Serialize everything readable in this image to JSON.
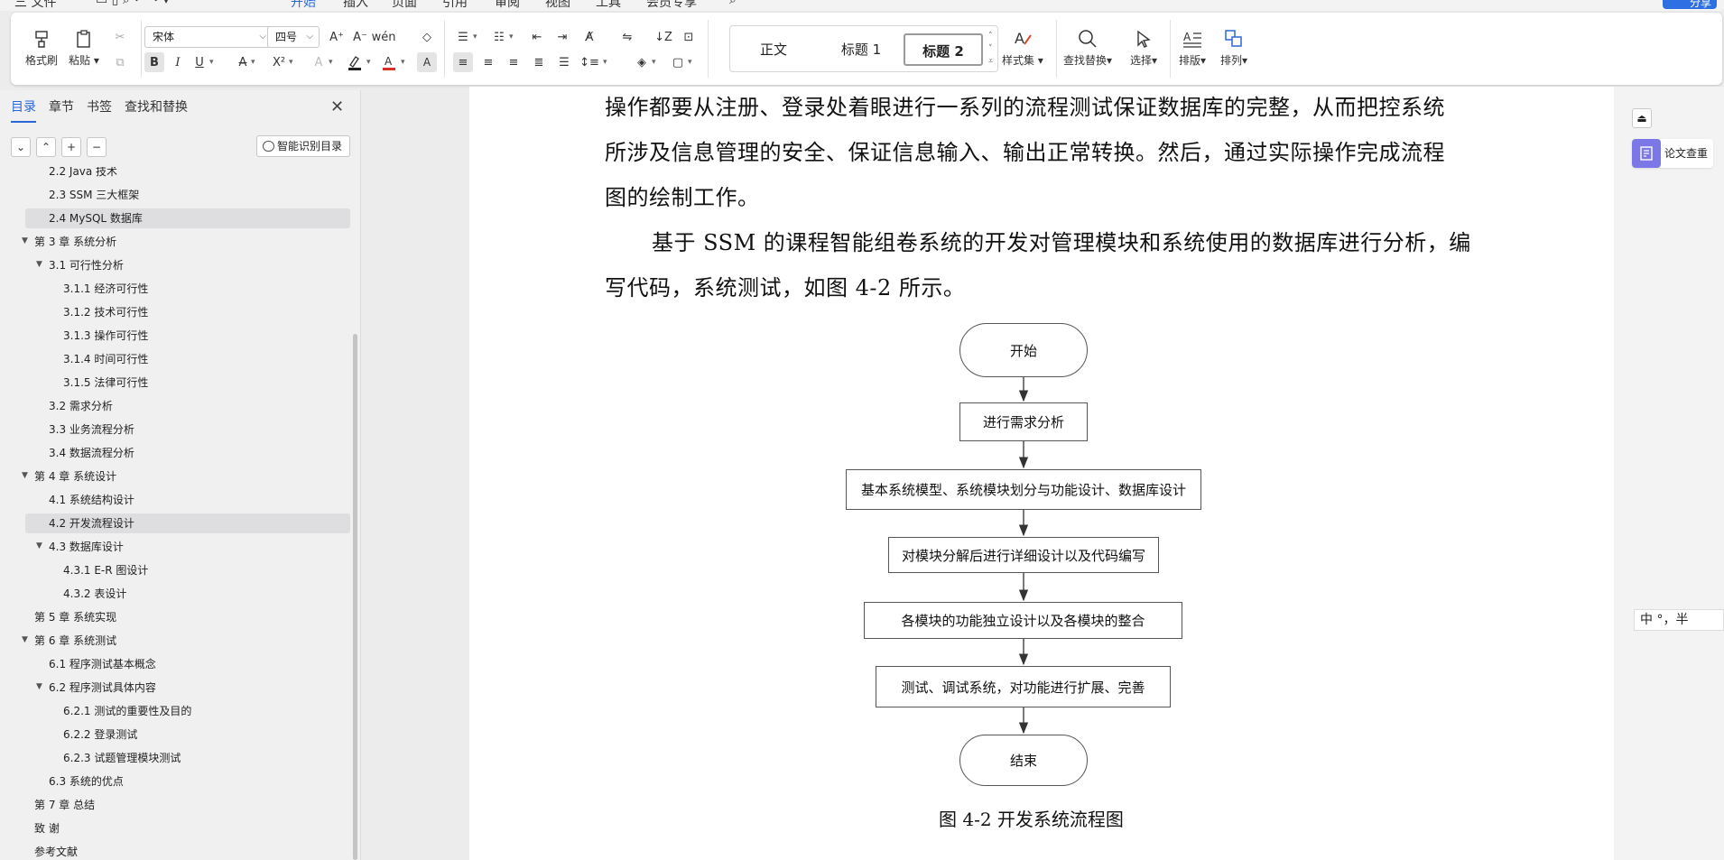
{
  "menu": {
    "file": "三 文件",
    "tabs": [
      "开始",
      "插入",
      "页面",
      "引用",
      "审阅",
      "视图",
      "工具",
      "会员专享"
    ],
    "active_tab": "开始",
    "share": "分享"
  },
  "ribbon": {
    "format_painter": "格式刷",
    "paste": "粘贴",
    "font_name": "宋体",
    "font_size": "四号",
    "styles": [
      "正文",
      "标题 1",
      "标题 2"
    ],
    "selected_style": "标题 2",
    "styles_menu": "样式集",
    "find_replace": "查找替换",
    "select": "选择",
    "typeset": "排版",
    "arrange": "排列",
    "colors": {
      "accent": "#2b66d9",
      "font_color": "#d93025",
      "highlight": "#1f1f1f"
    }
  },
  "nav": {
    "tabs": [
      "目录",
      "章节",
      "书签",
      "查找和替换"
    ],
    "active_tab": "目录",
    "smart_toc": "智能识别目录",
    "items": [
      {
        "label": "2.2 Java 技术",
        "level": 2
      },
      {
        "label": "2.3 SSM 三大框架",
        "level": 2
      },
      {
        "label": "2.4 MySQL 数据库",
        "level": 2,
        "highlighted": true
      },
      {
        "label": "第 3 章  系统分析",
        "level": 1,
        "expanded": true
      },
      {
        "label": "3.1 可行性分析",
        "level": 2,
        "expanded": true
      },
      {
        "label": "3.1.1 经济可行性",
        "level": 3
      },
      {
        "label": "3.1.2 技术可行性",
        "level": 3
      },
      {
        "label": "3.1.3 操作可行性",
        "level": 3
      },
      {
        "label": "3.1.4  时间可行性",
        "level": 3
      },
      {
        "label": "3.1.5  法律可行性",
        "level": 3
      },
      {
        "label": "3.2 需求分析",
        "level": 2
      },
      {
        "label": "3.3 业务流程分析",
        "level": 2
      },
      {
        "label": "3.4 数据流程分析",
        "level": 2
      },
      {
        "label": "第 4 章  系统设计",
        "level": 1,
        "expanded": true
      },
      {
        "label": "4.1 系统结构设计",
        "level": 2
      },
      {
        "label": "4.2 开发流程设计",
        "level": 2,
        "highlighted": true
      },
      {
        "label": "4.3 数据库设计",
        "level": 2,
        "expanded": true
      },
      {
        "label": "4.3.1 E-R 图设计",
        "level": 3
      },
      {
        "label": "4.3.2 表设计",
        "level": 3
      },
      {
        "label": "第 5 章    系统实现",
        "level": 1
      },
      {
        "label": "第 6 章    系统测试",
        "level": 1,
        "expanded": true
      },
      {
        "label": "6.1  程序测试基本概念",
        "level": 2
      },
      {
        "label": "6.2  程序测试具体内容",
        "level": 2,
        "expanded": true
      },
      {
        "label": "6.2.1  测试的重要性及目的",
        "level": 3
      },
      {
        "label": "6.2.2 登录测试",
        "level": 3
      },
      {
        "label": "6.2.3 试题管理模块测试",
        "level": 3
      },
      {
        "label": "6.3  系统的优点",
        "level": 2
      },
      {
        "label": "第 7 章    总结",
        "level": 1
      },
      {
        "label": "致    谢",
        "level": 1
      },
      {
        "label": "参考文献",
        "level": 1
      }
    ]
  },
  "document": {
    "lines": [
      "操作都要从注册、登录处着眼进行一系列的流程测试保证数据库的完整，从而把控系统",
      "所涉及信息管理的安全、保证信息输入、输出正常转换。然后，通过实际操作完成流程",
      "图的绘制工作。",
      "基于 SSM 的课程智能组卷系统的开发对管理模块和系统使用的数据库进行分析，编",
      "写代码，系统测试，如图 4-2 所示。"
    ],
    "flowchart": [
      "开始",
      "进行需求分析",
      "基本系统模型、系统模块划分与功能设计、数据库设计",
      "对模块分解后进行详细设计以及代码编写",
      "各模块的功能独立设计以及各模块的整合",
      "测试、调试系统，对功能进行扩展、完善",
      "结束"
    ],
    "caption": "图 4-2 开发系统流程图"
  },
  "right_panel": {
    "paper_check": "论文查重",
    "ime": "中 °，半"
  }
}
